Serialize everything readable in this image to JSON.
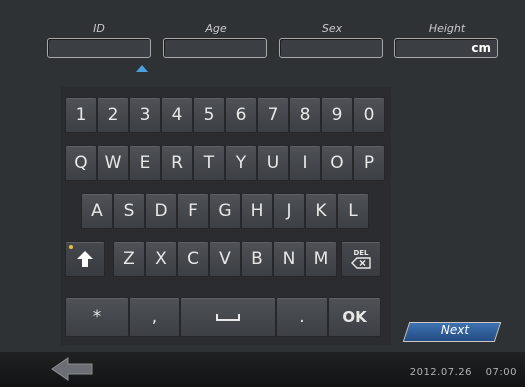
{
  "fields": [
    {
      "label": "ID",
      "value": "",
      "unit": ""
    },
    {
      "label": "Age",
      "value": "",
      "unit": ""
    },
    {
      "label": "Sex",
      "value": "",
      "unit": ""
    },
    {
      "label": "Height",
      "value": "",
      "unit": "cm"
    }
  ],
  "keyboard": {
    "row1": [
      "1",
      "2",
      "3",
      "4",
      "5",
      "6",
      "7",
      "8",
      "9",
      "0"
    ],
    "row2": [
      "Q",
      "W",
      "E",
      "R",
      "T",
      "Y",
      "U",
      "I",
      "O",
      "P"
    ],
    "row3": [
      "A",
      "S",
      "D",
      "F",
      "G",
      "H",
      "J",
      "K",
      "L"
    ],
    "row4": [
      "Z",
      "X",
      "C",
      "V",
      "B",
      "N",
      "M"
    ],
    "delete_label": "DEL",
    "bottom": {
      "asterisk": "*",
      "comma": ",",
      "space": "␣",
      "period": ".",
      "ok": "OK"
    }
  },
  "next_label": "Next",
  "footer": {
    "date": "2012.07.26",
    "time": "07:00"
  },
  "colors": {
    "accent": "#4aa3e0",
    "next": "#2f5e9e",
    "shift_dot": "#e6c23a"
  }
}
